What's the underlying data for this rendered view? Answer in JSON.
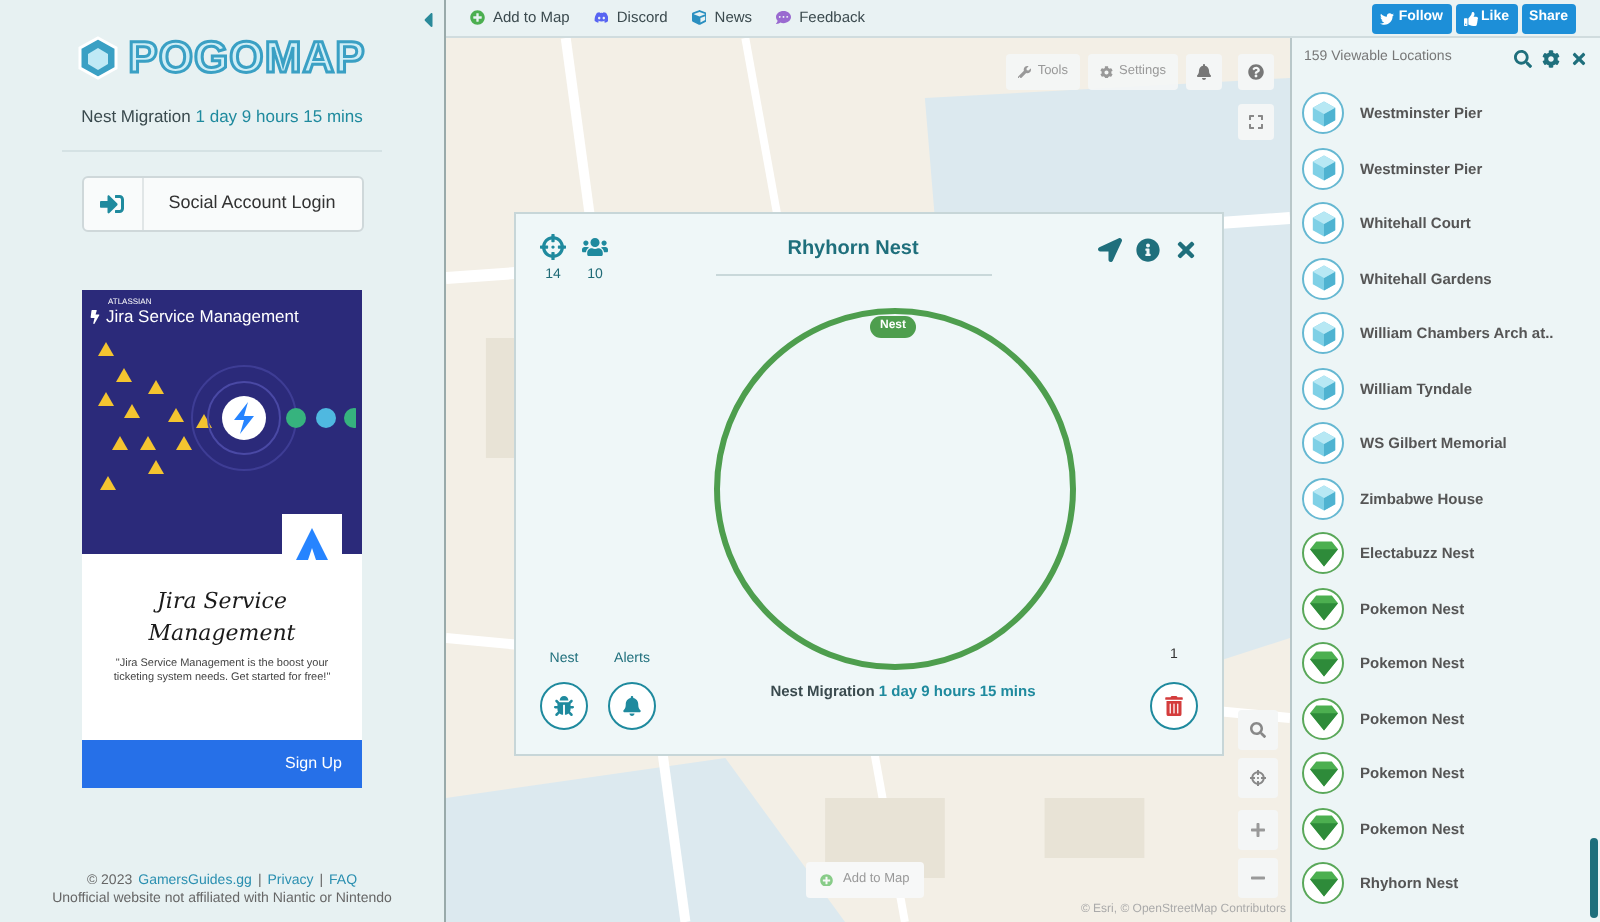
{
  "sidebar": {
    "logo": "POGOMAP",
    "migration": {
      "label": "Nest Migration",
      "value": "1 day 9 hours 15 mins"
    },
    "login_button": "Social Account Login",
    "ad": {
      "brand": "ATLASSIAN",
      "product": "Jira Service Management",
      "headline": "Jira Service Management",
      "blurb": "\"Jira Service Management is the boost your ticketing system needs. Get started for free!\"",
      "cta": "Sign Up"
    },
    "footer": {
      "copyright": "© 2023",
      "site_link": "GamersGuides.gg",
      "separator_1": "|",
      "privacy_link": "Privacy",
      "separator_2": "|",
      "faq_link": "FAQ",
      "disclaimer": "Unofficial website not affiliated with Niantic or Nintendo"
    }
  },
  "top_bar": {
    "links": [
      {
        "label": "Add to Map",
        "kind": "add"
      },
      {
        "label": "Discord",
        "kind": "discord"
      },
      {
        "label": "News",
        "kind": "news"
      },
      {
        "label": "Feedback",
        "kind": "feedback"
      }
    ],
    "social": [
      {
        "label": "Follow",
        "kind": "twitter"
      },
      {
        "label": "Like",
        "kind": "facebook"
      },
      {
        "label": "Share",
        "kind": "share"
      }
    ]
  },
  "map": {
    "kind": "picture",
    "tools_button": "Tools",
    "settings_button": "Settings",
    "add_button": "Add to Map",
    "attribution": "© Esri, © OpenStreetMap Contributors"
  },
  "popup": {
    "title": "Rhyhorn Nest",
    "spawn_count": "14",
    "people_count": "10",
    "nest_tag": "Nest",
    "nest_button_label": "Nest",
    "alerts_button_label": "Alerts",
    "delete_count": "1",
    "migration": {
      "label": "Nest Migration",
      "value": "1 day 9 hours 15 mins"
    }
  },
  "locations": {
    "header": "159 Viewable Locations",
    "items": [
      {
        "name": "Westminster Pier",
        "kind": "pokestop"
      },
      {
        "name": "Westminster Pier",
        "kind": "pokestop"
      },
      {
        "name": "Whitehall Court",
        "kind": "pokestop"
      },
      {
        "name": "Whitehall Gardens",
        "kind": "pokestop"
      },
      {
        "name": "William Chambers Arch at..",
        "kind": "pokestop"
      },
      {
        "name": "William Tyndale",
        "kind": "pokestop"
      },
      {
        "name": "WS Gilbert Memorial",
        "kind": "pokestop"
      },
      {
        "name": "Zimbabwe House",
        "kind": "pokestop"
      },
      {
        "name": "Electabuzz Nest",
        "kind": "nest"
      },
      {
        "name": "Pokemon Nest",
        "kind": "nest"
      },
      {
        "name": "Pokemon Nest",
        "kind": "nest"
      },
      {
        "name": "Pokemon Nest",
        "kind": "nest"
      },
      {
        "name": "Pokemon Nest",
        "kind": "nest"
      },
      {
        "name": "Pokemon Nest",
        "kind": "nest"
      },
      {
        "name": "Rhyhorn Nest",
        "kind": "nest"
      }
    ]
  }
}
